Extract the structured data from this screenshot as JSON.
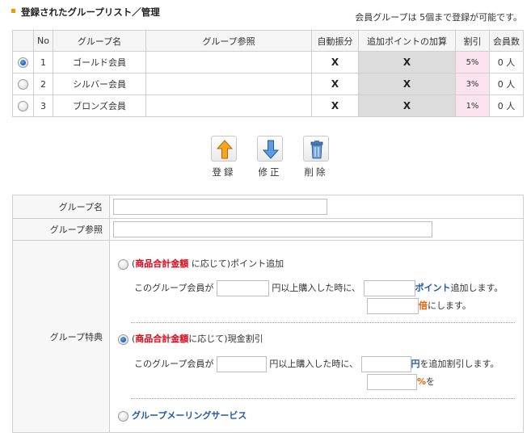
{
  "header": {
    "title": "登録されたグループリスト／管理",
    "note": "会員グループは 5個まで登録が可能です。"
  },
  "table": {
    "columns": [
      "No",
      "グループ名",
      "グループ参照",
      "自動振分",
      "追加ポイントの加算",
      "割引",
      "会員数"
    ],
    "rows": [
      {
        "selected": true,
        "no": "1",
        "name": "ゴールド会員",
        "ref": "",
        "auto": "X",
        "points": "X",
        "discount": "5%",
        "members": "0 人"
      },
      {
        "selected": false,
        "no": "2",
        "name": "シルバー会員",
        "ref": "",
        "auto": "X",
        "points": "X",
        "discount": "3%",
        "members": "0 人"
      },
      {
        "selected": false,
        "no": "3",
        "name": "ブロンズ会員",
        "ref": "",
        "auto": "X",
        "points": "X",
        "discount": "1%",
        "members": "0 人"
      }
    ]
  },
  "actions": {
    "register": {
      "label": "登録",
      "icon": "up-arrow-icon"
    },
    "edit": {
      "label": "修正",
      "icon": "down-arrow-icon"
    },
    "delete": {
      "label": "削除",
      "icon": "trash-icon"
    }
  },
  "form": {
    "group_name_label": "グループ名",
    "group_name_value": "",
    "group_ref_label": "グループ参照",
    "group_ref_value": "",
    "benefit_label": "グループ特典",
    "option_points": {
      "selected": false,
      "paren_open": "(",
      "basis": "商品合計金額",
      "after_basis": " に応じて)ポイント追加",
      "line1_prefix": "このグループ会員が",
      "line1_mid": "円以上購入した時に、",
      "line1_unit": "ポイント",
      "line1_suffix": "追加します。",
      "line2_unit": "倍",
      "line2_suffix": "にします。"
    },
    "option_cash": {
      "selected": true,
      "paren_open": "(",
      "basis": "商品合計金額",
      "after_basis": "に応じて)現金割引",
      "line1_prefix": "このグループ会員が",
      "line1_mid": "円以上購入した時に、",
      "line1_unit": "円",
      "line1_suffix": "を追加割引します。",
      "line2_unit": "%",
      "line2_suffix": "を"
    },
    "option_mailing": {
      "selected": false,
      "label": "グループメーリングサービス"
    }
  },
  "colors": {
    "accent_orange": "#f39800",
    "basis_red": "#e60012",
    "unit_blue": "#1d5aa8",
    "header_grey": "#dcdcdc",
    "discount_pink": "#fbe3f0"
  }
}
